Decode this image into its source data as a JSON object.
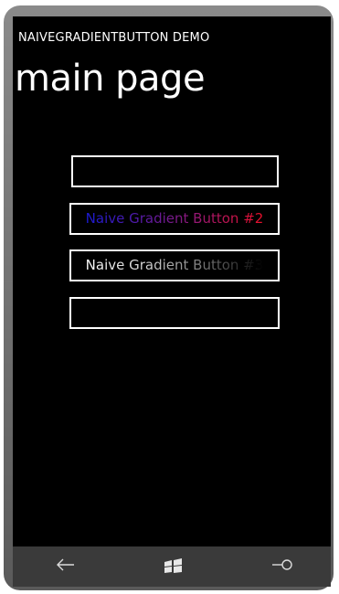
{
  "app": {
    "title": "NAIVEGRADIENTBUTTON DEMO",
    "page_title": "main page"
  },
  "buttons": [
    {
      "label": ""
    },
    {
      "label": "Naive Gradient Button #2",
      "gradient": [
        "#1a1ad0",
        "#e8102a"
      ]
    },
    {
      "label": "Naive Gradient Button #3",
      "gradient": [
        "#ffffff",
        "#000000"
      ]
    },
    {
      "label": ""
    }
  ],
  "appbar": {
    "back_icon": "back-arrow-icon",
    "start_icon": "windows-start-icon",
    "search_icon": "search-icon"
  },
  "colors": {
    "background": "#000000",
    "foreground": "#ffffff",
    "appbar": "#3a3a3a"
  }
}
